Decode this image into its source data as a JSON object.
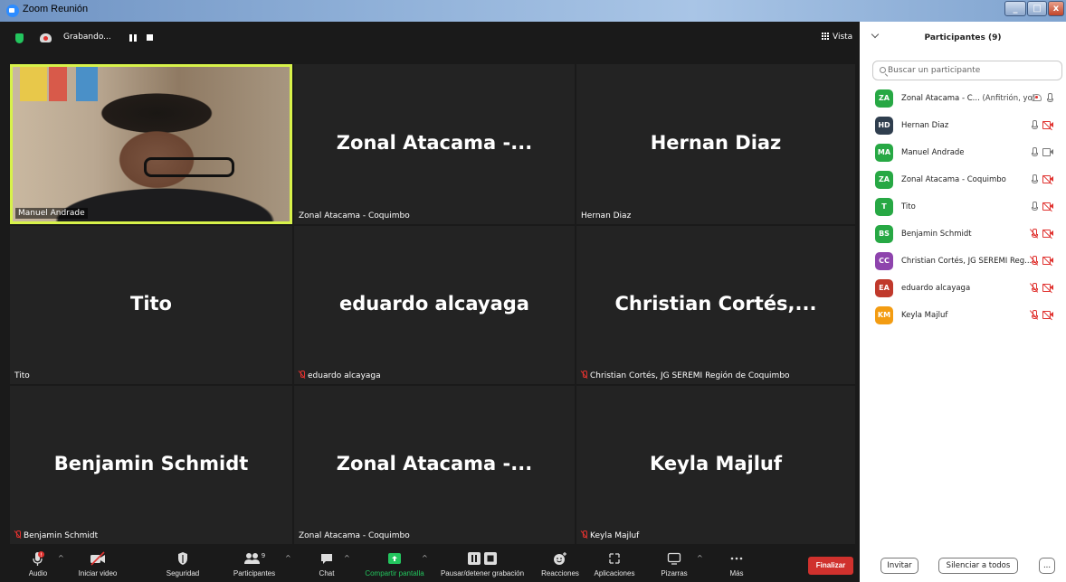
{
  "window": {
    "title": "Zoom Reunión",
    "min": "_",
    "max": "□",
    "close": "x"
  },
  "topbar": {
    "recording_label": "Grabando...",
    "view_label": "Vista"
  },
  "tiles": [
    {
      "big": "",
      "caption": "Manuel Andrade",
      "muted": false,
      "video": true
    },
    {
      "big": "Zonal Atacama -...",
      "caption": "Zonal Atacama - Coquimbo",
      "muted": false,
      "video": false
    },
    {
      "big": "Hernan Diaz",
      "caption": "Hernan Diaz",
      "muted": false,
      "video": false
    },
    {
      "big": "Tito",
      "caption": "Tito",
      "muted": false,
      "video": false
    },
    {
      "big": "eduardo alcayaga",
      "caption": "eduardo alcayaga",
      "muted": true,
      "video": false
    },
    {
      "big": "Christian Cortés,...",
      "caption": "Christian Cortés, JG SEREMI Región de Coquimbo",
      "muted": true,
      "video": false
    },
    {
      "big": "Benjamin Schmidt",
      "caption": "Benjamin Schmidt",
      "muted": true,
      "video": false
    },
    {
      "big": "Zonal Atacama -...",
      "caption": "Zonal Atacama - Coquimbo",
      "muted": false,
      "video": false
    },
    {
      "big": "Keyla Majluf",
      "caption": "Keyla Majluf",
      "muted": true,
      "video": false
    }
  ],
  "controls": {
    "audio": "Audio",
    "video": "Iniciar video",
    "security": "Seguridad",
    "participants": "Participantes",
    "participants_count": "9",
    "chat": "Chat",
    "share": "Compartir pantalla",
    "record": "Pausar/detener grabación",
    "reactions": "Reacciones",
    "apps": "Aplicaciones",
    "whiteboards": "Pizarras",
    "more": "Más",
    "end": "Finalizar",
    "audio_badge": "!"
  },
  "panel": {
    "title": "Participantes (9)",
    "search_placeholder": "Buscar un participante",
    "invite": "Invitar",
    "mute_all": "Silenciar a todos",
    "more": "..."
  },
  "participants": [
    {
      "initials": "ZA",
      "color": "#27a844",
      "name": "Zonal Atacama - C...",
      "suffix": "(Anfitrión, yo)",
      "mic": "on",
      "cam": "none",
      "recording": true
    },
    {
      "initials": "HD",
      "color": "#2f3e4e",
      "name": "Hernan Diaz",
      "suffix": "",
      "mic": "on",
      "cam": "off",
      "recording": false
    },
    {
      "initials": "MA",
      "color": "#27a844",
      "name": "Manuel Andrade",
      "suffix": "",
      "mic": "on",
      "cam": "on",
      "recording": false
    },
    {
      "initials": "ZA",
      "color": "#27a844",
      "name": "Zonal Atacama - Coquimbo",
      "suffix": "",
      "mic": "on",
      "cam": "off",
      "recording": false
    },
    {
      "initials": "T",
      "color": "#27a844",
      "name": "Tito",
      "suffix": "",
      "mic": "on",
      "cam": "off",
      "recording": false
    },
    {
      "initials": "BS",
      "color": "#27a844",
      "name": "Benjamin Schmidt",
      "suffix": "",
      "mic": "off",
      "cam": "off",
      "recording": false
    },
    {
      "initials": "CC",
      "color": "#8e44ad",
      "name": "Christian Cortés, JG SEREMI Reg...",
      "suffix": "",
      "mic": "off",
      "cam": "off",
      "recording": false
    },
    {
      "initials": "EA",
      "color": "#c0392b",
      "name": "eduardo alcayaga",
      "suffix": "",
      "mic": "off",
      "cam": "off",
      "recording": false
    },
    {
      "initials": "KM",
      "color": "#f39c12",
      "name": "Keyla Majluf",
      "suffix": "",
      "mic": "off",
      "cam": "off",
      "recording": false
    }
  ],
  "colors": {
    "active_speaker": "#d7f24a",
    "end_button": "#d0312d",
    "share_green": "#23c55e",
    "muted_red": "#e0322f"
  }
}
